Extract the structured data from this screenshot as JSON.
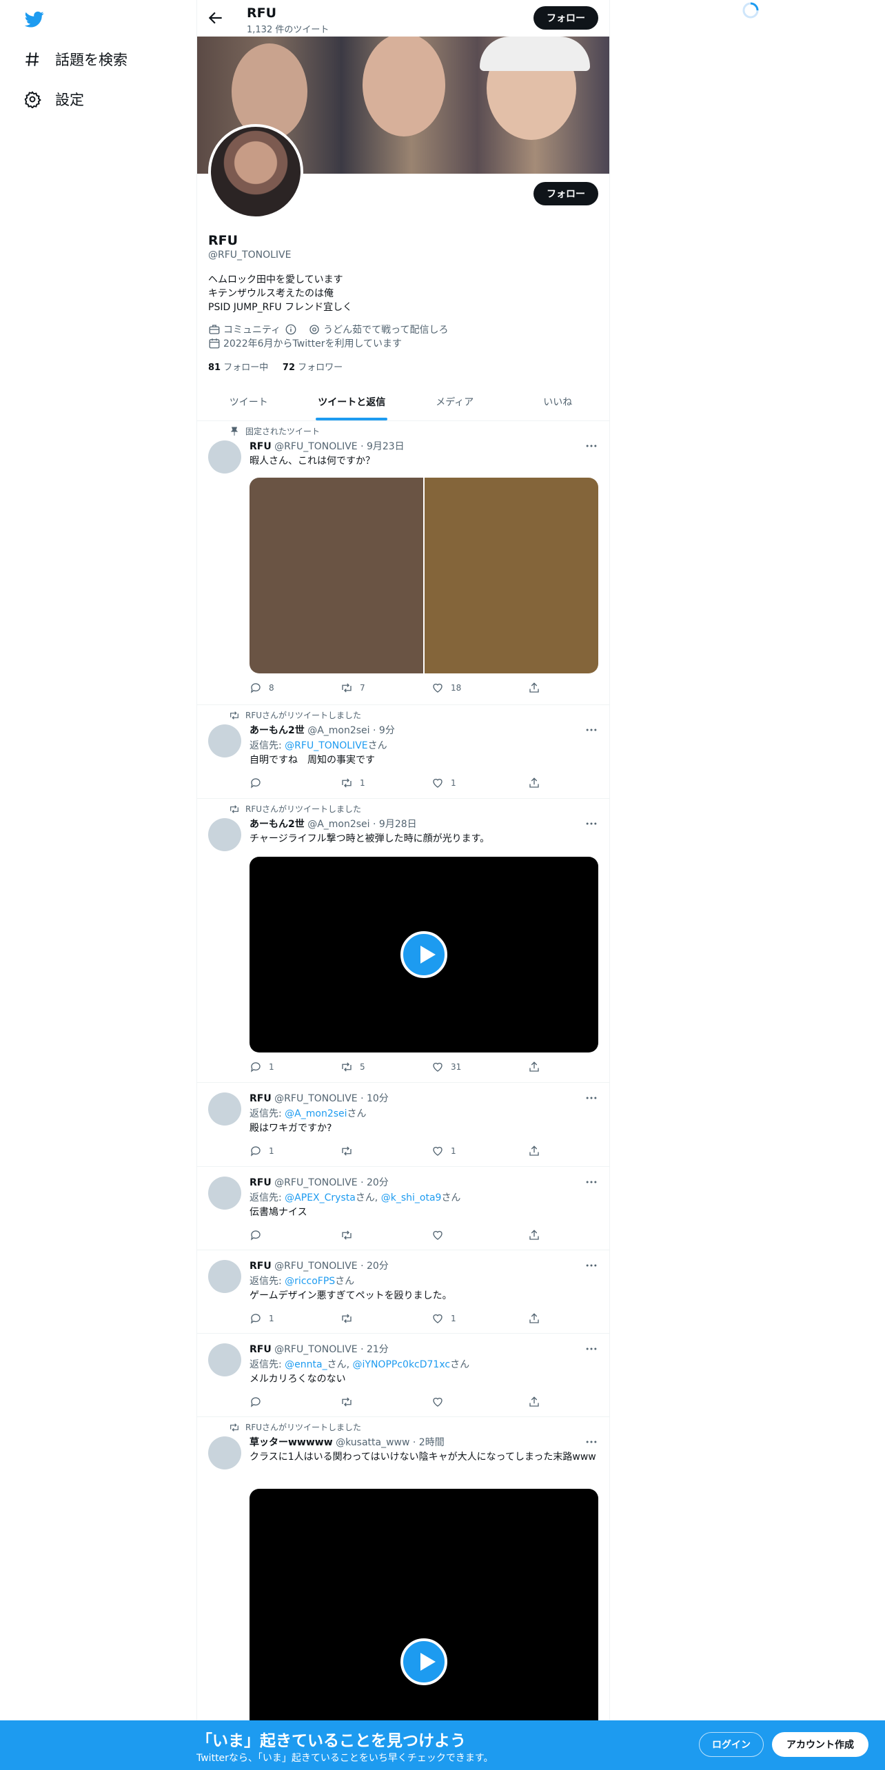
{
  "nav": {
    "logo_icon": "twitter-bird-icon",
    "items": [
      {
        "label": "話題を検索",
        "icon": "hashtag-icon"
      },
      {
        "label": "設定",
        "icon": "gear-icon"
      }
    ]
  },
  "header": {
    "title": "RFU",
    "tweet_count": "1,132 件のツイート",
    "follow_label": "フォロー"
  },
  "profile": {
    "name": "RFU",
    "handle": "@RFU_TONOLIVE",
    "follow_label": "フォロー",
    "bio": [
      "ヘムロック田中を愛しています",
      "キテンザウルス考えたのは俺",
      "PSID JUMP_RFU フレンド宜しく"
    ],
    "category": "コミュニティ",
    "location": "うどん茹でて戦って配信しろ",
    "joined": "2022年6月からTwitterを利用しています",
    "following_count": "81",
    "following_label": "フォロー中",
    "followers_count": "72",
    "followers_label": "フォロワー"
  },
  "tabs": [
    "ツイート",
    "ツイートと返信",
    "メディア",
    "いいね"
  ],
  "active_tab": "ツイートと返信",
  "tweets": [
    {
      "context": "固定されたツイート",
      "name": "RFU",
      "meta": "@RFU_TONOLIVE · 9月23日",
      "text": "暇人さん、これは何ですか？",
      "replies": "8",
      "retweets": "7",
      "likes": "18"
    },
    {
      "context": "RFUさんがリツイートしました",
      "name": "あーもん2世",
      "meta": "@A_mon2sei · 9分",
      "reply_prefix": "返信先: ",
      "reply_to": "@RFU_TONOLIVE",
      "reply_suffix": "さん",
      "text": "自明ですね　周知の事実です",
      "replies": "",
      "retweets": "1",
      "likes": "1"
    },
    {
      "context": "RFUさんがリツイートしました",
      "name": "あーもん2世",
      "meta": "@A_mon2sei · 9月28日",
      "text": "チャージライフル撃つ時と被弾した時に顔が光ります。",
      "replies": "1",
      "retweets": "5",
      "likes": "31"
    },
    {
      "name": "RFU",
      "meta": "@RFU_TONOLIVE · 10分",
      "reply_prefix": "返信先: ",
      "reply_to": "@A_mon2sei",
      "reply_suffix": "さん",
      "text": "殿はワキガですか?",
      "replies": "1",
      "retweets": "",
      "likes": "1"
    },
    {
      "name": "RFU",
      "meta": "@RFU_TONOLIVE · 20分",
      "reply_prefix": "返信先: ",
      "reply_to": "@APEX_Crysta",
      "reply_mid": "さん, ",
      "reply_to2": "@k_shi_ota9",
      "reply_suffix": "さん",
      "text": "伝書鳩ナイス",
      "replies": "",
      "retweets": "",
      "likes": ""
    },
    {
      "name": "RFU",
      "meta": "@RFU_TONOLIVE · 20分",
      "reply_prefix": "返信先: ",
      "reply_to": "@riccoFPS",
      "reply_suffix": "さん",
      "text": "ゲームデザイン悪すぎてペットを殴りました。",
      "replies": "1",
      "retweets": "",
      "likes": "1"
    },
    {
      "name": "RFU",
      "meta": "@RFU_TONOLIVE · 21分",
      "reply_prefix": "返信先: ",
      "reply_to": "@ennta_",
      "reply_mid": "さん, ",
      "reply_to2": "@iYNOPPc0kcD71xc",
      "reply_suffix": "さん",
      "text": "メルカリろくなのない",
      "replies": "",
      "retweets": "",
      "likes": ""
    },
    {
      "context": "RFUさんがリツイートしました",
      "name": "草ッターwwwww",
      "meta": "@kusatta_www · 2時間",
      "text": "クラスに1人はいる関わってはいけない陰キャが大人になってしまった末路www"
    }
  ],
  "bottom_bar": {
    "headline": "「いま」起きていることを見つけよう",
    "subline": "Twitterなら、「いま」起きていることをいち早くチェックできます。",
    "login_label": "ログイン",
    "signup_label": "アカウント作成"
  },
  "colors": {
    "accent": "#1d9bf0",
    "text": "#0f1419",
    "muted": "#536471"
  }
}
